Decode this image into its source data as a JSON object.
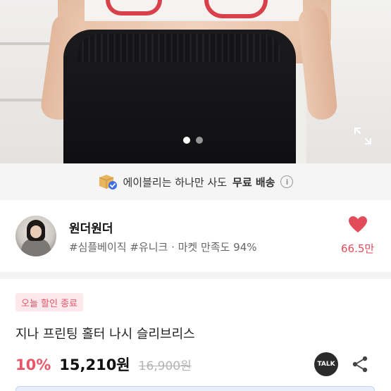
{
  "hero": {
    "image_pagination": {
      "total": 2,
      "active": 1
    },
    "icons": {
      "expand": "expand-icon"
    }
  },
  "shipping_banner": {
    "text_prefix": "에이블리는 하나만 사도",
    "text_bold": "무료 배송",
    "icons": {
      "box": "box-check-icon",
      "info": "info-icon"
    },
    "info_glyph": "i"
  },
  "shop": {
    "name": "원더원더",
    "tags": "#심플베이직 #유니크 · 마켓 만족도 94%",
    "likes": "66.5만",
    "icons": {
      "heart": "heart-icon"
    }
  },
  "product": {
    "badge": "오늘 할인 종료",
    "title": "지나 프린팅 홀터 나시 슬리브리스",
    "discount": "10%",
    "price": "15,210원",
    "original_price": "16,900원",
    "talk_label": "TALK",
    "icons": {
      "talk": "talk-icon",
      "share": "share-icon"
    }
  },
  "colors": {
    "accent_pink": "#e8566a",
    "heart_red": "#e14b5a",
    "banner_bg": "#f5f5f6"
  }
}
